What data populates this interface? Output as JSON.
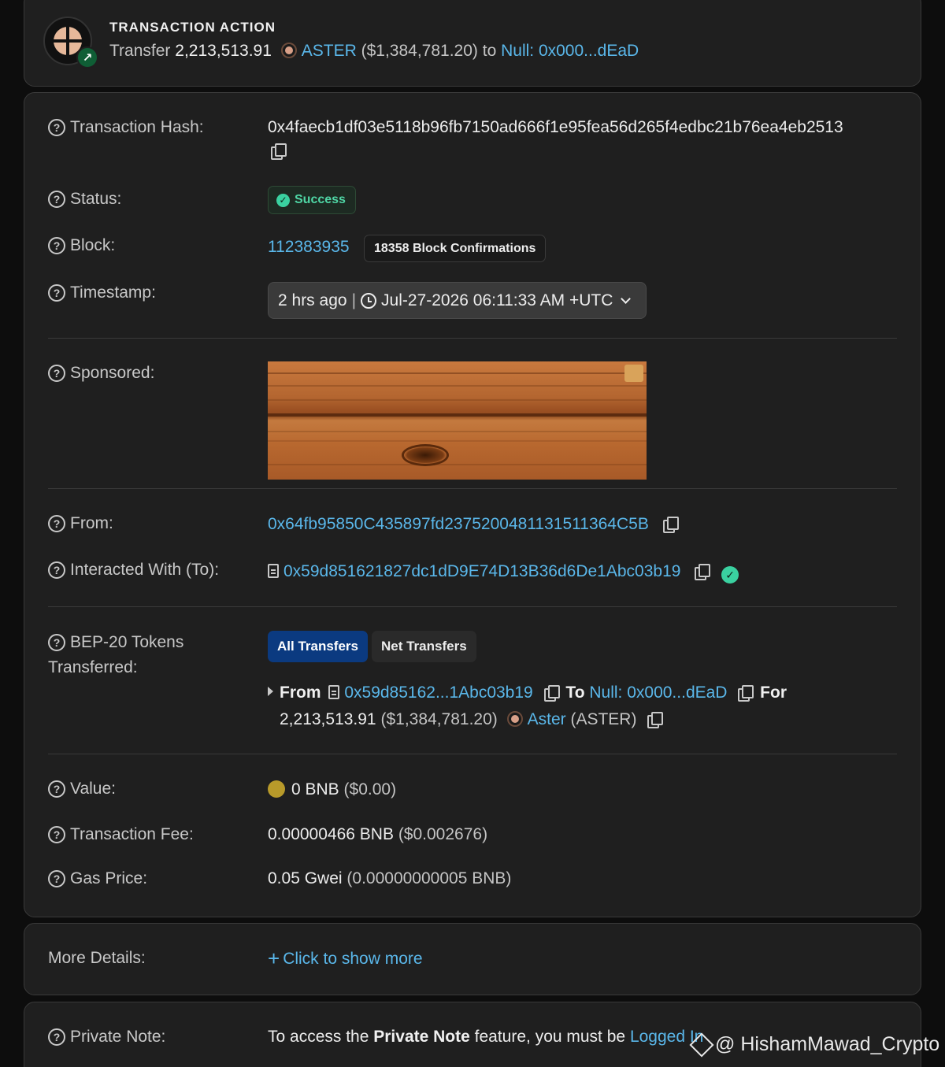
{
  "action": {
    "heading": "TRANSACTION ACTION",
    "verb": "Transfer",
    "amount": "2,213,513.91",
    "token": "ASTER",
    "usd": "($1,384,781.20)",
    "to_word": "to",
    "recipient": "Null: 0x000...dEaD"
  },
  "rows": {
    "hash": {
      "label": "Transaction Hash:",
      "value": "0x4faecb1df03e5118b96fb7150ad666f1e95fea56d265f4edbc21b76ea4eb2513"
    },
    "status": {
      "label": "Status:",
      "value": "Success"
    },
    "block": {
      "label": "Block:",
      "value": "112383935",
      "confirmations": "18358 Block Confirmations"
    },
    "timestamp": {
      "label": "Timestamp:",
      "relative": "2 hrs ago",
      "separator": "|",
      "absolute": "Jul-27-2026 06:11:33 AM +UTC"
    },
    "sponsored": {
      "label": "Sponsored:"
    },
    "from": {
      "label": "From:",
      "value": "0x64fb95850C435897fd2375200481131511364C5B"
    },
    "to": {
      "label": "Interacted With (To):",
      "value": "0x59d851621827dc1dD9E74D13B36d6De1Abc03b19"
    },
    "tokens": {
      "label_line1": "BEP-20 Tokens",
      "label_line2": "Transferred:",
      "tab_all": "All Transfers",
      "tab_net": "Net Transfers",
      "from_word": "From",
      "from_addr": "0x59d85162...1Abc03b19",
      "to_word": "To",
      "to_addr": "Null: 0x000...dEaD",
      "for_word": "For",
      "amount": "2,213,513.91",
      "usd": "($1,384,781.20)",
      "token_name": "Aster",
      "token_symbol": "(ASTER)"
    },
    "value": {
      "label": "Value:",
      "amount": "0 BNB",
      "usd": "($0.00)"
    },
    "fee": {
      "label": "Transaction Fee:",
      "amount": "0.00000466 BNB",
      "usd": "($0.002676)"
    },
    "gas": {
      "label": "Gas Price:",
      "amount": "0.05 Gwei",
      "bnb": "(0.00000000005 BNB)"
    }
  },
  "more": {
    "label": "More Details:",
    "link": "Click to show more"
  },
  "note": {
    "label": "Private Note:",
    "text_pre": "To access the",
    "text_bold": "Private Note",
    "text_post": "feature, you must be",
    "link": "Logged In"
  },
  "watermark": "@ HishamMawad_Crypto",
  "colors": {
    "link": "#5ab7ea",
    "success": "#3ad1a0",
    "tab_active": "#0b3a80"
  }
}
